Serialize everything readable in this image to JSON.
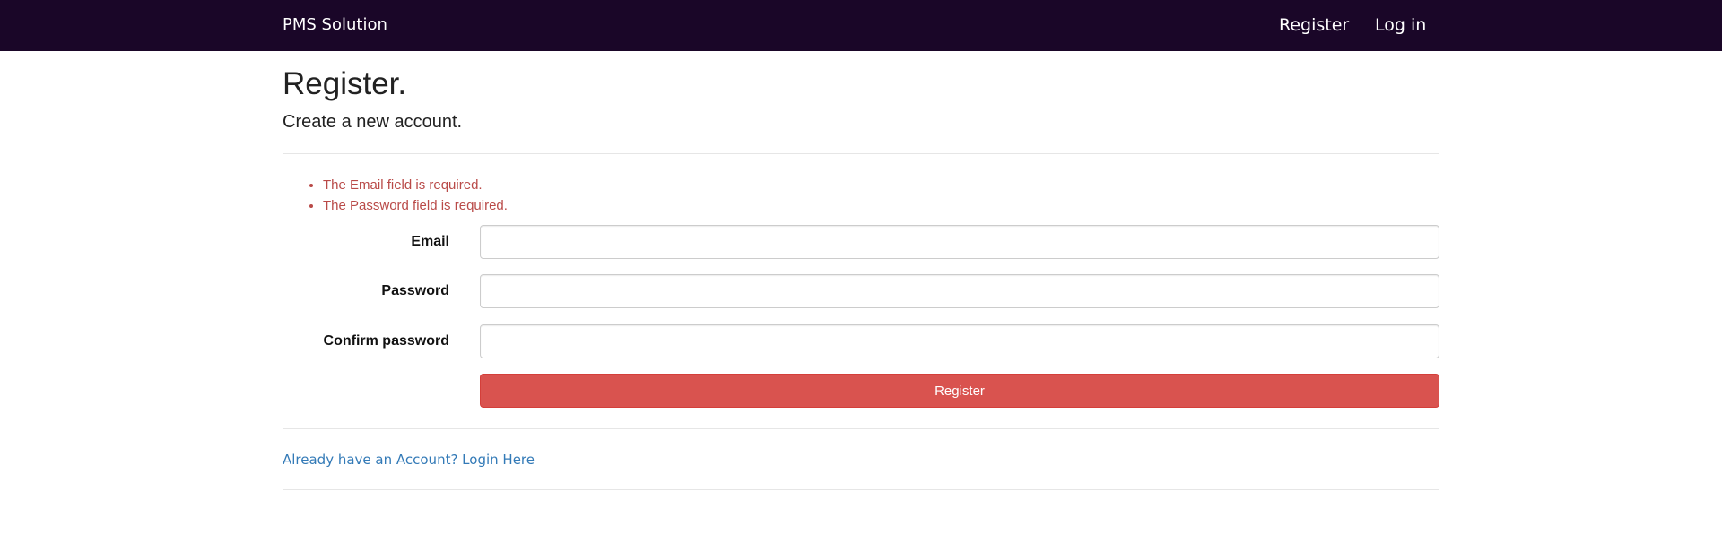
{
  "navbar": {
    "brand": "PMS Solution",
    "links": [
      "Register",
      "Log in"
    ],
    "background": "#1a0628"
  },
  "page": {
    "title": "Register.",
    "subtitle": "Create a new account."
  },
  "validation": {
    "errors": [
      "The Email field is required.",
      "The Password field is required."
    ],
    "color": "#b94a48"
  },
  "form": {
    "fields": [
      {
        "label": "Email",
        "value": "",
        "placeholder": ""
      },
      {
        "label": "Password",
        "value": "",
        "placeholder": ""
      },
      {
        "label": "Confirm password",
        "value": "",
        "placeholder": ""
      }
    ],
    "submit_label": "Register",
    "submit_color": "#d9534f"
  },
  "footer": {
    "login_link": "Already have an Account? Login Here",
    "link_color": "#337ab7"
  }
}
